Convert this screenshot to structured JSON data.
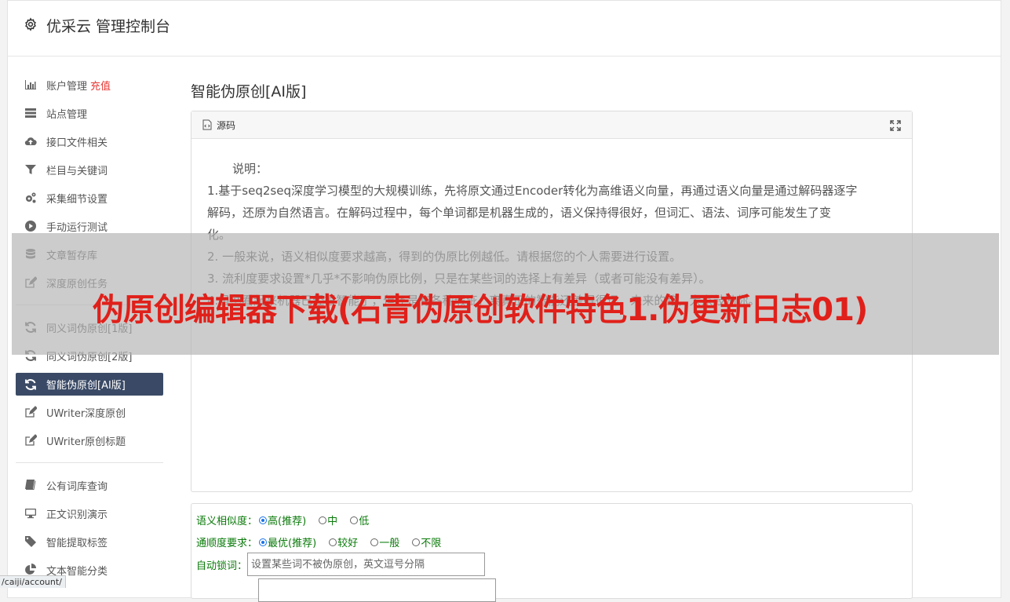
{
  "header": {
    "title": "优采云 管理控制台"
  },
  "sidebar": {
    "group1": [
      {
        "label": "账户管理",
        "tag": "充值",
        "icon": "bar-chart-icon"
      },
      {
        "label": "站点管理",
        "icon": "server-icon"
      },
      {
        "label": "接口文件相关",
        "icon": "cloud-upload-icon"
      },
      {
        "label": "栏目与关键词",
        "icon": "filter-icon"
      },
      {
        "label": "采集细节设置",
        "icon": "cogs-icon"
      },
      {
        "label": "手动运行测试",
        "icon": "play-circle-icon"
      },
      {
        "label": "文章暂存库",
        "icon": "database-icon"
      },
      {
        "label": "深度原创任务",
        "icon": "edit-icon"
      }
    ],
    "group2": [
      {
        "label": "同义词伪原创[1版]",
        "icon": "refresh-icon"
      },
      {
        "label": "同义词伪原创[2版]",
        "icon": "refresh-icon"
      },
      {
        "label": "智能伪原创[AI版]",
        "icon": "refresh-icon",
        "active": true
      },
      {
        "label": "UWriter深度原创",
        "icon": "edit-icon"
      },
      {
        "label": "UWriter原创标题",
        "icon": "edit-icon"
      }
    ],
    "group3": [
      {
        "label": "公有词库查询",
        "icon": "book-icon"
      },
      {
        "label": "正文识别演示",
        "icon": "desktop-icon"
      },
      {
        "label": "智能提取标签",
        "icon": "tag-icon"
      },
      {
        "label": "文本智能分类",
        "icon": "pie-chart-icon"
      }
    ]
  },
  "main": {
    "title": "智能伪原创[AI版]",
    "editor": {
      "toolbar_label": "源码",
      "lines": [
        "说明：",
        "1.基于seq2seq深度学习模型的大规模训练，先将原文通过Encoder转化为高维语义向量，再通过语义向量是通过解码器逐字",
        "解码，还原为自然语言。在解码过程中，每个单词都是机器生成的，语义保持得很好，但词汇、语法、词序可能发生了变",
        "化。",
        "2. 一般来说，语义相似度要求越高，得到的伪原比例越低。请根据您的个人需要进行设置。",
        "3. 流利度要求设置*几乎*不影响伪原比例，只是在某些词的选择上有差异（或者可能没有差异）。",
        "4.虽然看起来机器已经很智能了，但还是有各种瑕疵，离真正的智能还差得很远。未来的路，大家鼓励你。"
      ]
    },
    "options": {
      "similarity": {
        "label": "语义相似度：",
        "choices": [
          "高(推荐)",
          "中",
          "低"
        ],
        "selected": 0
      },
      "fluency": {
        "label": "通顺度要求：",
        "choices": [
          "最优(推荐)",
          "较好",
          "一般",
          "不限"
        ],
        "selected": 0
      },
      "lock": {
        "label": "自动锁词：",
        "placeholder": "设置某些词不被伪原创，英文逗号分隔"
      }
    }
  },
  "overlay": {
    "banner": "伪原创编辑器下载(石青伪原创软件特色1.伪更新日志01)"
  },
  "status_bar": {
    "url": "/caiji/account/"
  }
}
